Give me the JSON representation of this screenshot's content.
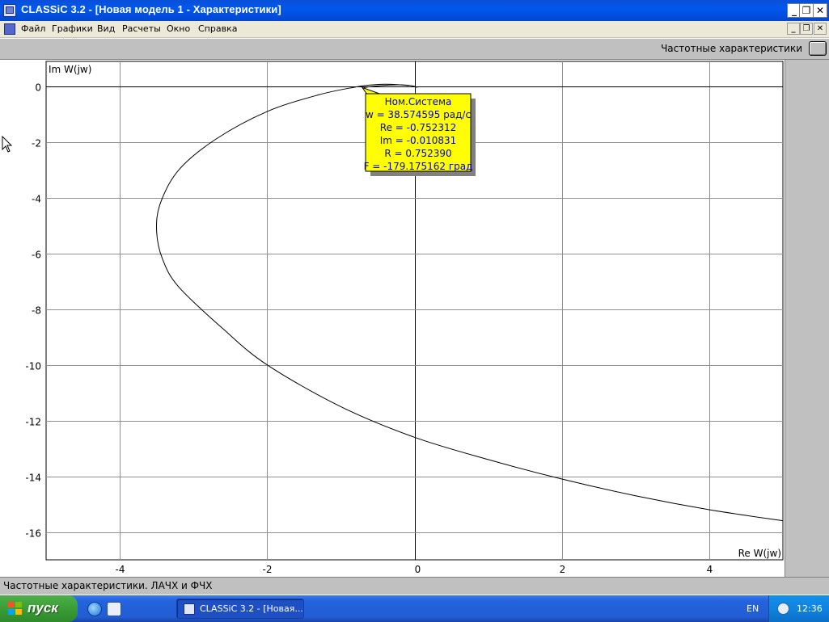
{
  "window": {
    "title": "CLASSiC 3.2 - [Новая модель 1 - Характеристики]",
    "min": "_",
    "restore": "❐",
    "close": "✕"
  },
  "menu": {
    "items": [
      "Файл",
      "Графики",
      "Вид",
      "Расчеты",
      "Окно",
      "Справка"
    ],
    "min": "_",
    "restore": "❐",
    "close": "✕"
  },
  "toolbar": {
    "panel_caption": "Частотные характеристики"
  },
  "chart_data": {
    "type": "line",
    "xlabel": "Re W(jw)",
    "ylabel": "Im W(jw)",
    "xlim": [
      -5,
      5
    ],
    "ylim": [
      -17,
      0.9
    ],
    "xticks": [
      -4,
      -2,
      0,
      2,
      4
    ],
    "yticks": [
      0,
      -2,
      -4,
      -6,
      -8,
      -10,
      -12,
      -14,
      -16
    ],
    "grid": true,
    "series": [
      {
        "color": "#000000",
        "x": [
          -0.08,
          -0.2,
          -0.4,
          -0.6,
          -0.8,
          -1.3,
          -2.0,
          -2.7,
          -3.2,
          -3.45,
          -3.5,
          -3.42,
          -3.2,
          -2.6,
          -2.0,
          -1.0,
          0.0,
          1.0,
          2.0,
          3.0,
          4.0,
          5.0
        ],
        "y": [
          0.03,
          0.06,
          0.08,
          0.05,
          -0.02,
          -0.3,
          -0.9,
          -1.9,
          -3.0,
          -4.2,
          -5.2,
          -6.2,
          -7.2,
          -8.7,
          -10.0,
          -11.5,
          -12.6,
          -13.4,
          -14.1,
          -14.7,
          -15.2,
          -15.6
        ]
      }
    ],
    "tooltip": {
      "lines": [
        "Ном.Система",
        "w = 38.574595 рад/с",
        "Re = -0.752312",
        "Im = -0.010831",
        "R = 0.752390",
        "F = -179.175162 град"
      ],
      "background": "#ffff00",
      "text_color": "#0000cc"
    }
  },
  "statusbar": {
    "text": "Частотные характеристики. ЛАЧХ и ФЧХ"
  },
  "taskbar": {
    "start_label": "пуск",
    "task_label": "CLASSiC 3.2 - [Новая...",
    "lang": "EN",
    "clock": "12:36"
  },
  "icons": {
    "app": "app-window-icon",
    "ie": "internet-explorer-icon",
    "tray": "speaker-icon"
  }
}
